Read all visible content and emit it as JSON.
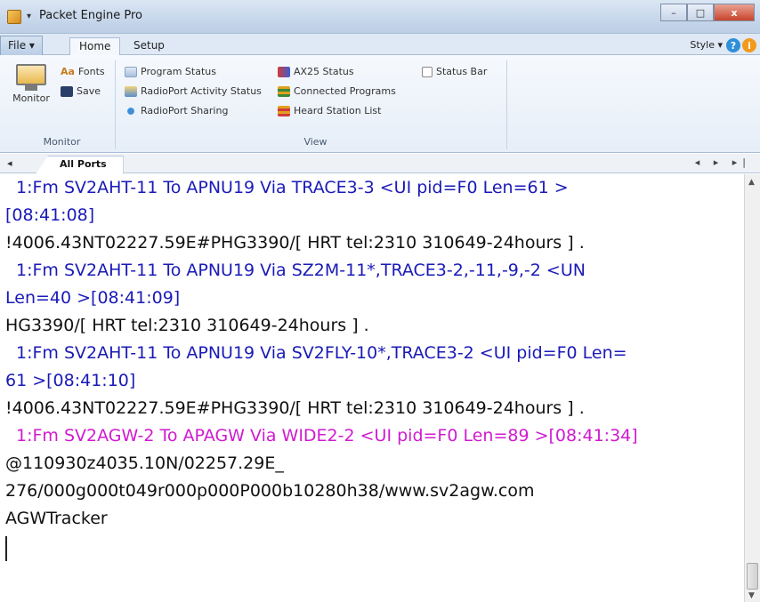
{
  "window": {
    "title": "Packet Engine Pro",
    "controls": {
      "minimize": "–",
      "maximize": "□",
      "close": "x"
    }
  },
  "ribbon_tabs": {
    "file": "File ▾",
    "home": "Home",
    "setup": "Setup",
    "style": "Style ▾",
    "help1": "?",
    "help2": "i"
  },
  "ribbon": {
    "monitor_group": {
      "label": "Monitor",
      "monitor_button": "Monitor",
      "fonts": "Fonts",
      "save": "Save"
    },
    "view_group": {
      "label": "View",
      "program_status": "Program Status",
      "radioport_activity_status": "RadioPort Activity Status",
      "radioport_sharing": "RadioPort Sharing",
      "ax25_status": "AX25 Status",
      "connected_programs": "Connected Programs",
      "heard_station_list": "Heard Station List",
      "status_bar": "Status Bar"
    }
  },
  "doc_tabs": {
    "nav_first": "◂",
    "active_tab": "All Ports",
    "nav_right": "◂ ▸ ▸|"
  },
  "monitor_lines": [
    {
      "text": "1:Fm SV2AHT-11 To APNU19 Via TRACE3-3 <UI pid=F0 Len=61 >",
      "kind": "hdr"
    },
    {
      "text": "[08:41:08]",
      "kind": "hdr-cont"
    },
    {
      "text": "!4006.43NT02227.59E#PHG3390/[ HRT tel:2310 310649-24hours ] .",
      "kind": "data"
    },
    {
      "text": "1:Fm SV2AHT-11 To APNU19 Via SZ2M-11*,TRACE3-2,-11,-9,-2 <UN",
      "kind": "hdr"
    },
    {
      "text": "Len=40 >[08:41:09]",
      "kind": "hdr-cont"
    },
    {
      "text": "HG3390/[ HRT tel:2310 310649-24hours ] .",
      "kind": "data"
    },
    {
      "text": "1:Fm SV2AHT-11 To APNU19 Via SV2FLY-10*,TRACE3-2 <UI pid=F0 Len=",
      "kind": "hdr"
    },
    {
      "text": "61 >[08:41:10]",
      "kind": "hdr-cont"
    },
    {
      "text": "!4006.43NT02227.59E#PHG3390/[ HRT tel:2310 310649-24hours ] .",
      "kind": "data"
    },
    {
      "text": "1:Fm SV2AGW-2 To APAGW Via WIDE2-2 <UI pid=F0 Len=89 >[08:41:34]",
      "kind": "magenta"
    },
    {
      "text": "@110930z4035.10N/02257.29E_",
      "kind": "data"
    },
    {
      "text": "276/000g000t049r000p000P000b10280h38/www.sv2agw.com",
      "kind": "data"
    },
    {
      "text": "AGWTracker",
      "kind": "data"
    }
  ],
  "colors": {
    "header_blue": "#1a1ab8",
    "header_magenta": "#d01ad0",
    "data_text": "#111111"
  }
}
